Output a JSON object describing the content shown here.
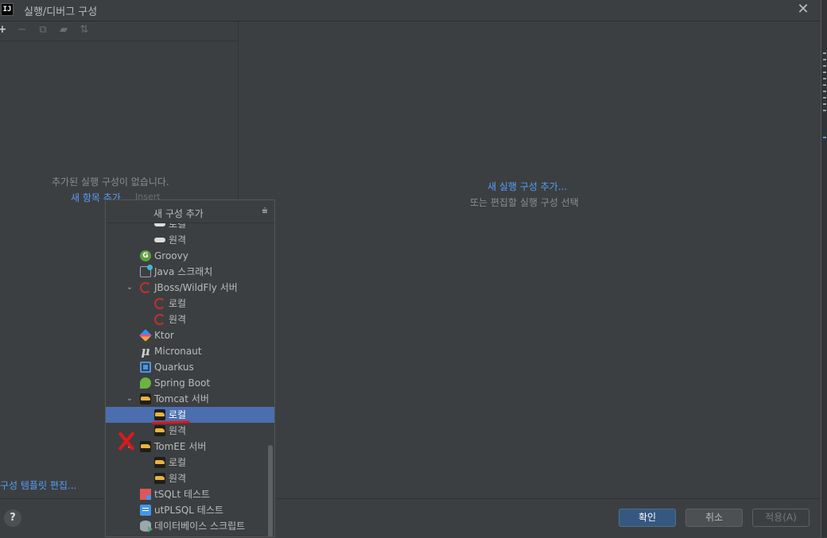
{
  "window": {
    "title": "실행/디버그 구성",
    "app_icon_text": "IJ"
  },
  "toolbar": {
    "buttons": [
      "add-icon",
      "remove-icon",
      "copy-icon",
      "move-to-folder-icon",
      "sort-icon"
    ]
  },
  "left_panel": {
    "empty_message": "추가된 실행 구성이 없습니다.",
    "add_link": "새 항목 추가",
    "insert_hint": "Insert",
    "templates_link": "구성 템플릿 편집..."
  },
  "right_panel": {
    "add_link": "새 실행 구성 추가...",
    "hint": "또는 편집할 실행 구성 선택"
  },
  "popup": {
    "title": "새 구성 추가",
    "items": [
      {
        "label": "로컬",
        "icon": "cloud-icon"
      },
      {
        "label": "원격",
        "icon": "cloud-icon"
      },
      {
        "label": "Groovy",
        "icon": "groovy-icon"
      },
      {
        "label": "Java 스크래치",
        "icon": "java-scratch-icon"
      },
      {
        "label": "JBoss/WildFly 서버",
        "icon": "jboss-icon"
      },
      {
        "label": "로컬",
        "icon": "jboss-icon"
      },
      {
        "label": "원격",
        "icon": "jboss-icon"
      },
      {
        "label": "Ktor",
        "icon": "ktor-icon"
      },
      {
        "label": "Micronaut",
        "icon": "micronaut-icon"
      },
      {
        "label": "Quarkus",
        "icon": "quarkus-icon"
      },
      {
        "label": "Spring Boot",
        "icon": "spring-boot-icon"
      },
      {
        "label": "Tomcat 서버",
        "icon": "tomcat-icon"
      },
      {
        "label": "로컬",
        "icon": "tomcat-icon",
        "selected": true
      },
      {
        "label": "원격",
        "icon": "tomcat-icon"
      },
      {
        "label": "TomEE 서버",
        "icon": "tomee-icon"
      },
      {
        "label": "로컬",
        "icon": "tomee-icon"
      },
      {
        "label": "원격",
        "icon": "tomee-icon"
      },
      {
        "label": "tSQLt 테스트",
        "icon": "tsqlt-icon"
      },
      {
        "label": "utPLSQL 테스트",
        "icon": "utplsql-icon"
      },
      {
        "label": "데이터베이스 스크립트",
        "icon": "database-script-icon"
      }
    ]
  },
  "buttons": {
    "help": "?",
    "ok": "확인",
    "cancel": "취소",
    "apply": "적용(A)"
  },
  "colors": {
    "background": "#3c3f41",
    "link": "#589df6",
    "selection": "#4b6eaf",
    "annotation": "#e01818"
  }
}
